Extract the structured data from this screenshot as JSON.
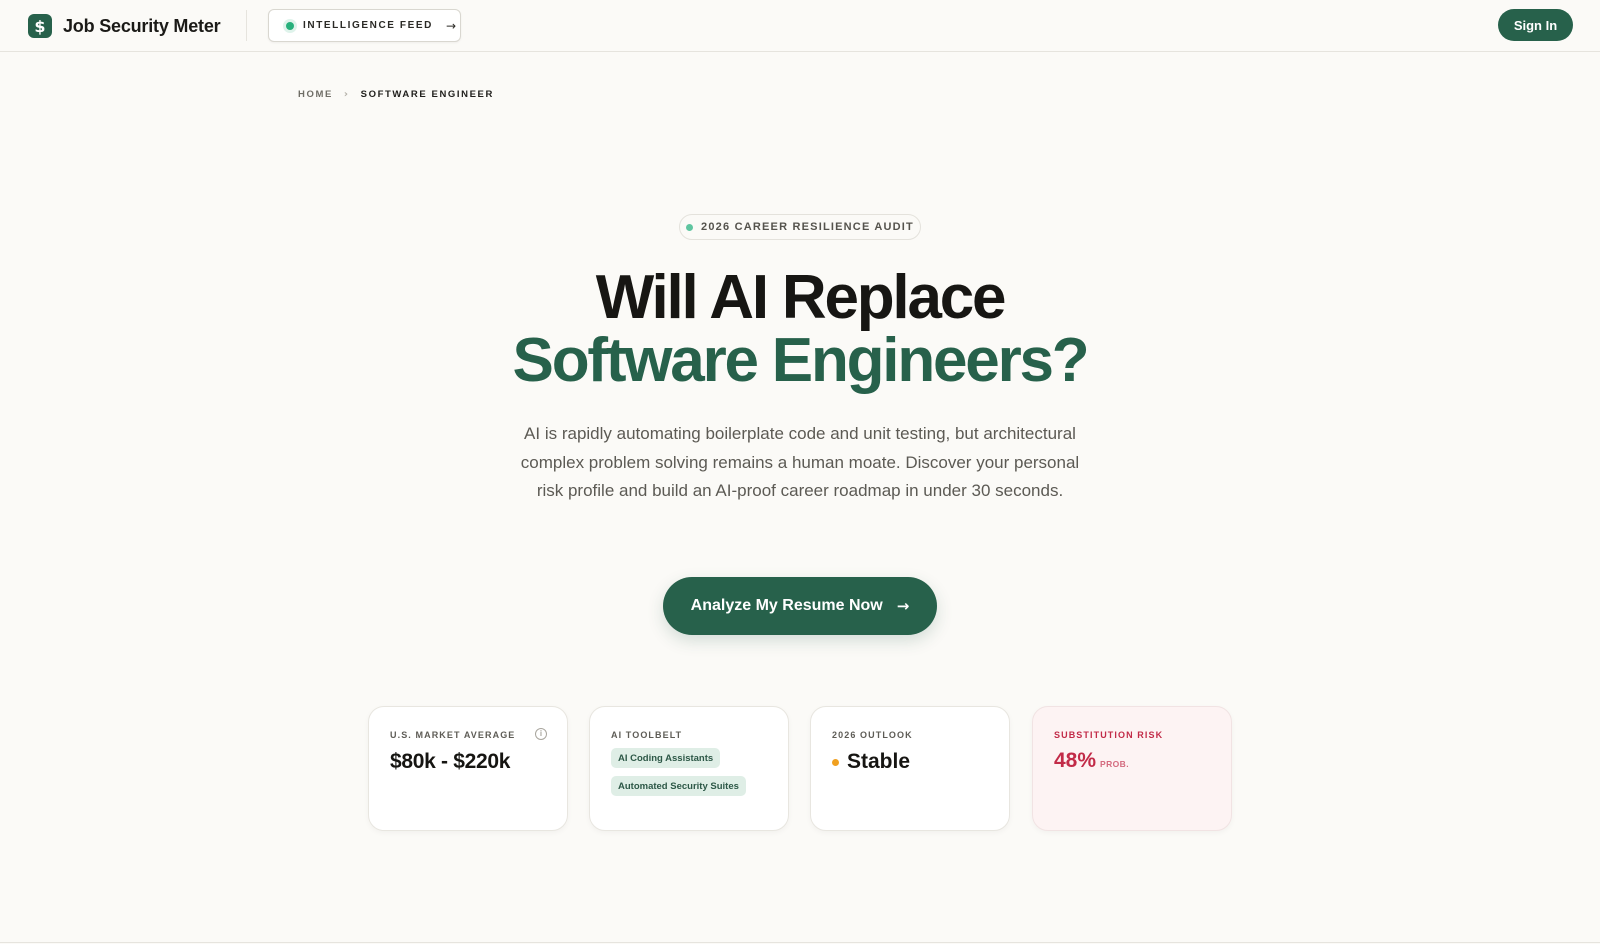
{
  "header": {
    "brand_icon": "$",
    "brand_name": "Job Security Meter",
    "feed_label": "INTELLIGENCE FEED",
    "feed_arrow": "→",
    "signin_label": "Sign In"
  },
  "breadcrumb": {
    "home": "HOME",
    "separator": "›",
    "current": "SOFTWARE ENGINEER"
  },
  "hero": {
    "badge": "2026 CAREER RESILIENCE AUDIT",
    "title_line1": "Will AI Replace",
    "title_line2": "Software Engineers?",
    "description": "AI is rapidly automating boilerplate code and unit testing, but architectural complex problem solving remains a human moate. Discover your personal risk profile and build an AI-proof career roadmap in under 30 seconds.",
    "cta_label": "Analyze My Resume Now",
    "cta_arrow": "→"
  },
  "cards": {
    "market": {
      "label": "U.S. MARKET AVERAGE",
      "info_icon": "i",
      "value": "$80k - $220k"
    },
    "toolbelt": {
      "label": "AI TOOLBELT",
      "tags": [
        "AI Coding Assistants",
        "Automated Security Suites"
      ]
    },
    "outlook": {
      "label": "2026 OUTLOOK",
      "value": "Stable"
    },
    "risk": {
      "label": "SUBSTITUTION RISK",
      "value": "48%",
      "unit": "PROB."
    }
  },
  "colors": {
    "brand": "#27614b",
    "background": "#fbfaf7",
    "risk": "#c22b48",
    "outlook_dot": "#f0a020",
    "live_dot": "#27b07c"
  },
  "icons": {
    "brand": "dollar-icon",
    "feed_status": "live-dot-icon",
    "arrow": "arrow-right-icon",
    "info": "info-icon"
  }
}
